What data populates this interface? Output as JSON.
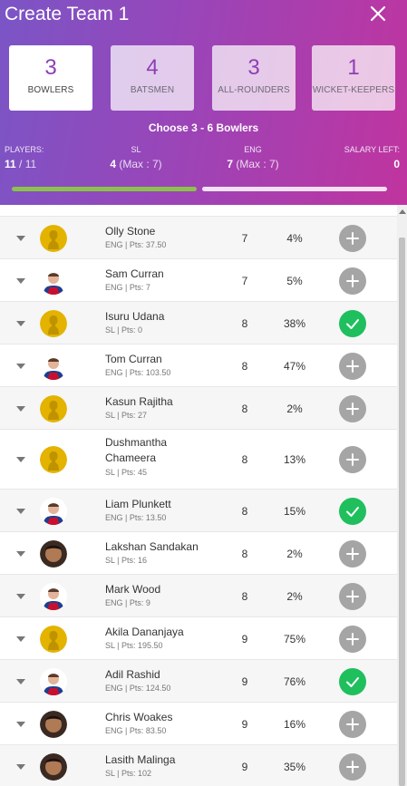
{
  "header": {
    "title": "Create Team 1",
    "close_icon": "close-icon",
    "tabs": [
      {
        "count": "3",
        "label": "BOWLERS"
      },
      {
        "count": "4",
        "label": "BATSMEN"
      },
      {
        "count": "3",
        "label": "ALL-ROUNDERS"
      },
      {
        "count": "1",
        "label": "WICKET-KEEPERS"
      }
    ],
    "hint": "Choose 3 - 6 Bowlers",
    "stats": {
      "players_label": "PLAYERS:",
      "players_value": "11",
      "players_total": "/ 11",
      "team1_label": "SL",
      "team1_value": "4",
      "team1_max": "(Max : 7)",
      "team2_label": "ENG",
      "team2_value": "7",
      "team2_max": "(Max : 7)",
      "salary_label": "SALARY LEFT:",
      "salary_value": "0"
    },
    "progress_fraction": 0.5
  },
  "colors": {
    "accent_purple": "#8e3fb3",
    "selected_green": "#1fbf5d",
    "add_gray": "#a5a5a5",
    "progress_green": "#8bc34a"
  },
  "players": [
    {
      "name": "Olly Stone",
      "meta": "ENG | Pts: 37.50",
      "credits": "7",
      "sel": "4%",
      "selected": false,
      "avatar": "placeholder"
    },
    {
      "name": "Sam Curran",
      "meta": "ENG | Pts: 7",
      "credits": "7",
      "sel": "5%",
      "selected": false,
      "avatar": "eng"
    },
    {
      "name": "Isuru Udana",
      "meta": "SL | Pts: 0",
      "credits": "8",
      "sel": "38%",
      "selected": true,
      "avatar": "placeholder"
    },
    {
      "name": "Tom Curran",
      "meta": "ENG | Pts: 103.50",
      "credits": "8",
      "sel": "47%",
      "selected": false,
      "avatar": "eng"
    },
    {
      "name": "Kasun Rajitha",
      "meta": "SL | Pts: 27",
      "credits": "8",
      "sel": "2%",
      "selected": false,
      "avatar": "placeholder"
    },
    {
      "name": "Dushmantha Chameera",
      "meta": "SL | Pts: 45",
      "credits": "8",
      "sel": "13%",
      "selected": false,
      "avatar": "placeholder"
    },
    {
      "name": "Liam Plunkett",
      "meta": "ENG | Pts: 13.50",
      "credits": "8",
      "sel": "15%",
      "selected": true,
      "avatar": "eng"
    },
    {
      "name": "Lakshan Sandakan",
      "meta": "SL | Pts: 16",
      "credits": "8",
      "sel": "2%",
      "selected": false,
      "avatar": "photo"
    },
    {
      "name": "Mark Wood",
      "meta": "ENG | Pts: 9",
      "credits": "8",
      "sel": "2%",
      "selected": false,
      "avatar": "eng"
    },
    {
      "name": "Akila Dananjaya",
      "meta": "SL | Pts: 195.50",
      "credits": "9",
      "sel": "75%",
      "selected": false,
      "avatar": "placeholder"
    },
    {
      "name": "Adil Rashid",
      "meta": "ENG | Pts: 124.50",
      "credits": "9",
      "sel": "76%",
      "selected": true,
      "avatar": "eng"
    },
    {
      "name": "Chris Woakes",
      "meta": "ENG | Pts: 83.50",
      "credits": "9",
      "sel": "16%",
      "selected": false,
      "avatar": "photo"
    },
    {
      "name": "Lasith Malinga",
      "meta": "SL | Pts: 102",
      "credits": "9",
      "sel": "35%",
      "selected": false,
      "avatar": "photo"
    }
  ]
}
